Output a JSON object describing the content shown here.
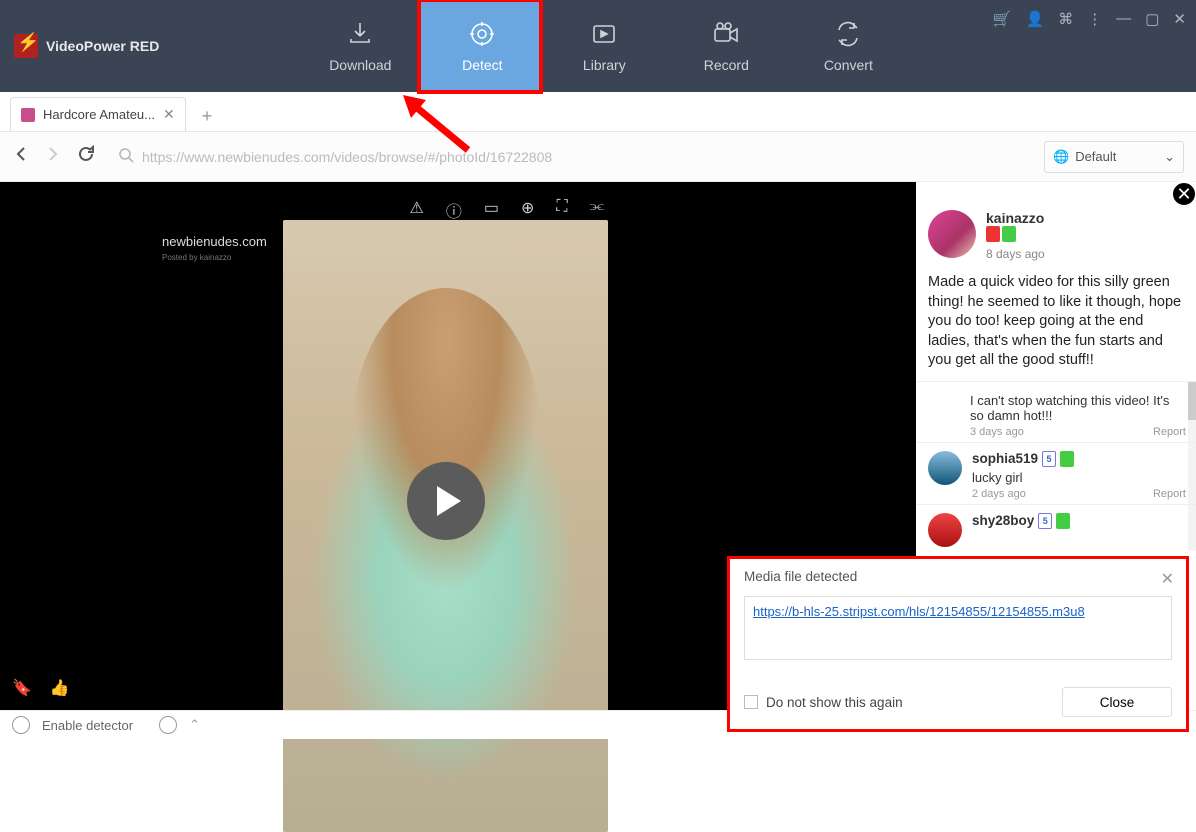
{
  "app": {
    "title": "VideoPower RED"
  },
  "nav": {
    "download": "Download",
    "detect": "Detect",
    "library": "Library",
    "record": "Record",
    "convert": "Convert"
  },
  "tab": {
    "title": "Hardcore  Amateu..."
  },
  "address": {
    "url": "https://www.newbienudes.com/videos/browse/#/photoId/16722808",
    "default_label": "Default"
  },
  "site": {
    "logo": "newbienudes.com",
    "sub": "Posted by kainazzo"
  },
  "video_toolbar": {
    "warn": "⚠",
    "info": "ⓘ",
    "theater": "▭",
    "zoom": "⊕",
    "full": "⛶",
    "share": "⫘"
  },
  "post": {
    "user": "kainazzo",
    "time": "8 days ago",
    "text": "Made a quick video for this silly green thing! he seemed to like it though, hope you do too! keep going at the end ladies, that's when the fun starts and you get all the good stuff!!"
  },
  "comments": {
    "c0_body": "I can't stop watching this video! It's so damn hot!!!",
    "c0_time": "3 days ago",
    "c1_name": "sophia519",
    "c1_body": "lucky girl",
    "c1_time": "2 days ago",
    "c2_name": "shy28boy",
    "report": "Report"
  },
  "popup": {
    "title": "Media file detected",
    "url": "https://b-hls-25.stripst.com/hls/12154855/12154855.m3u8",
    "checkbox": "Do not show this again",
    "close": "Close"
  },
  "footer": {
    "detector": "Enable detector"
  }
}
